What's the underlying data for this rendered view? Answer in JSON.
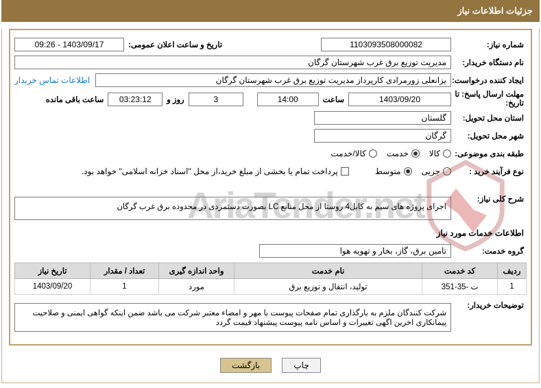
{
  "panelTitle": "جزئیات اطلاعات نیاز",
  "labels": {
    "needNo": "شماره نیاز:",
    "announceDate": "تاریخ و ساعت اعلان عمومی:",
    "buyerOrg": "نام دستگاه خریدار:",
    "creator": "ایجاد کننده درخواست:",
    "contactLink": "اطلاعات تماس خریدار",
    "deadline": "مهلت ارسال پاسخ: تا تاریخ:",
    "hour": "ساعت",
    "daysAnd": "روز و",
    "remain": "ساعت باقی مانده",
    "province": "استان محل تحویل:",
    "city": "شهر محل تحویل:",
    "category": "طبقه بندی موضوعی:",
    "catGoods": "کالا",
    "catService": "خدمت",
    "catBoth": "کالا/خدمت",
    "buyType": "نوع فرآیند خرید :",
    "minor": "جزیی",
    "medium": "متوسط",
    "payNote": "پرداخت تمام یا بخشی از مبلغ خرید،از محل \"اسناد خزانه اسلامی\" خواهد بود.",
    "needDesc": "شرح کلی نیاز:",
    "servicesInfo": "اطلاعات خدمات مورد نیاز",
    "serviceGroup": "گروه خدمت:",
    "buyerNotes": "توضیحات خریدار:"
  },
  "values": {
    "needNo": "1103093508000082",
    "announceDate": "1403/09/17 - 09:26",
    "buyerOrg": "مدیریت توزیع برق غرب شهرستان گرگان",
    "creator": "یزانعلی زورمرادی کارپرداز مدیریت توزیع برق غرب شهرستان گرگان",
    "deadlineDate": "1403/09/20",
    "deadlineHour": "14:00",
    "days": "3",
    "countdown": "03:23:12",
    "province": "گلستان",
    "city": "گرگان",
    "needDescText": "اجرای پروژه های سیم به کابل4 روستا از محل منابع LC بصورت دستمزدی در محدوده برق غرب گرگان",
    "serviceGroupVal": "تامین برق، گاز، بخار و تهویه هوا",
    "buyerNotesText": "شرکت کنندگان ملزم به بارگذاری تمام صفحات پیوست با مهر و امضاء معتبر شرکت می باشد ضمن اینکه گواهی ایمنی و صلاحیت پیمانکاری اخرین اگهی تغییرات و اساس نامه پیوست پیشنهاد قیمت گردد"
  },
  "radios": {
    "categorySelected": "خدمت",
    "buyTypeSelected": "متوسط"
  },
  "table": {
    "headers": {
      "row": "ردیف",
      "code": "کد خدمت",
      "name": "نام خدمت",
      "unit": "واحد اندازه گیری",
      "qty": "تعداد / مقدار",
      "needDate": "تاریخ نیاز"
    },
    "rows": [
      {
        "row": "1",
        "code": "ت -35-351",
        "name": "تولید، انتقال و توزیع برق",
        "unit": "مورد",
        "qty": "1",
        "needDate": "1403/09/20"
      }
    ]
  },
  "buttons": {
    "print": "چاپ",
    "back": "بازگشت"
  },
  "watermark": "AriaTender.net"
}
